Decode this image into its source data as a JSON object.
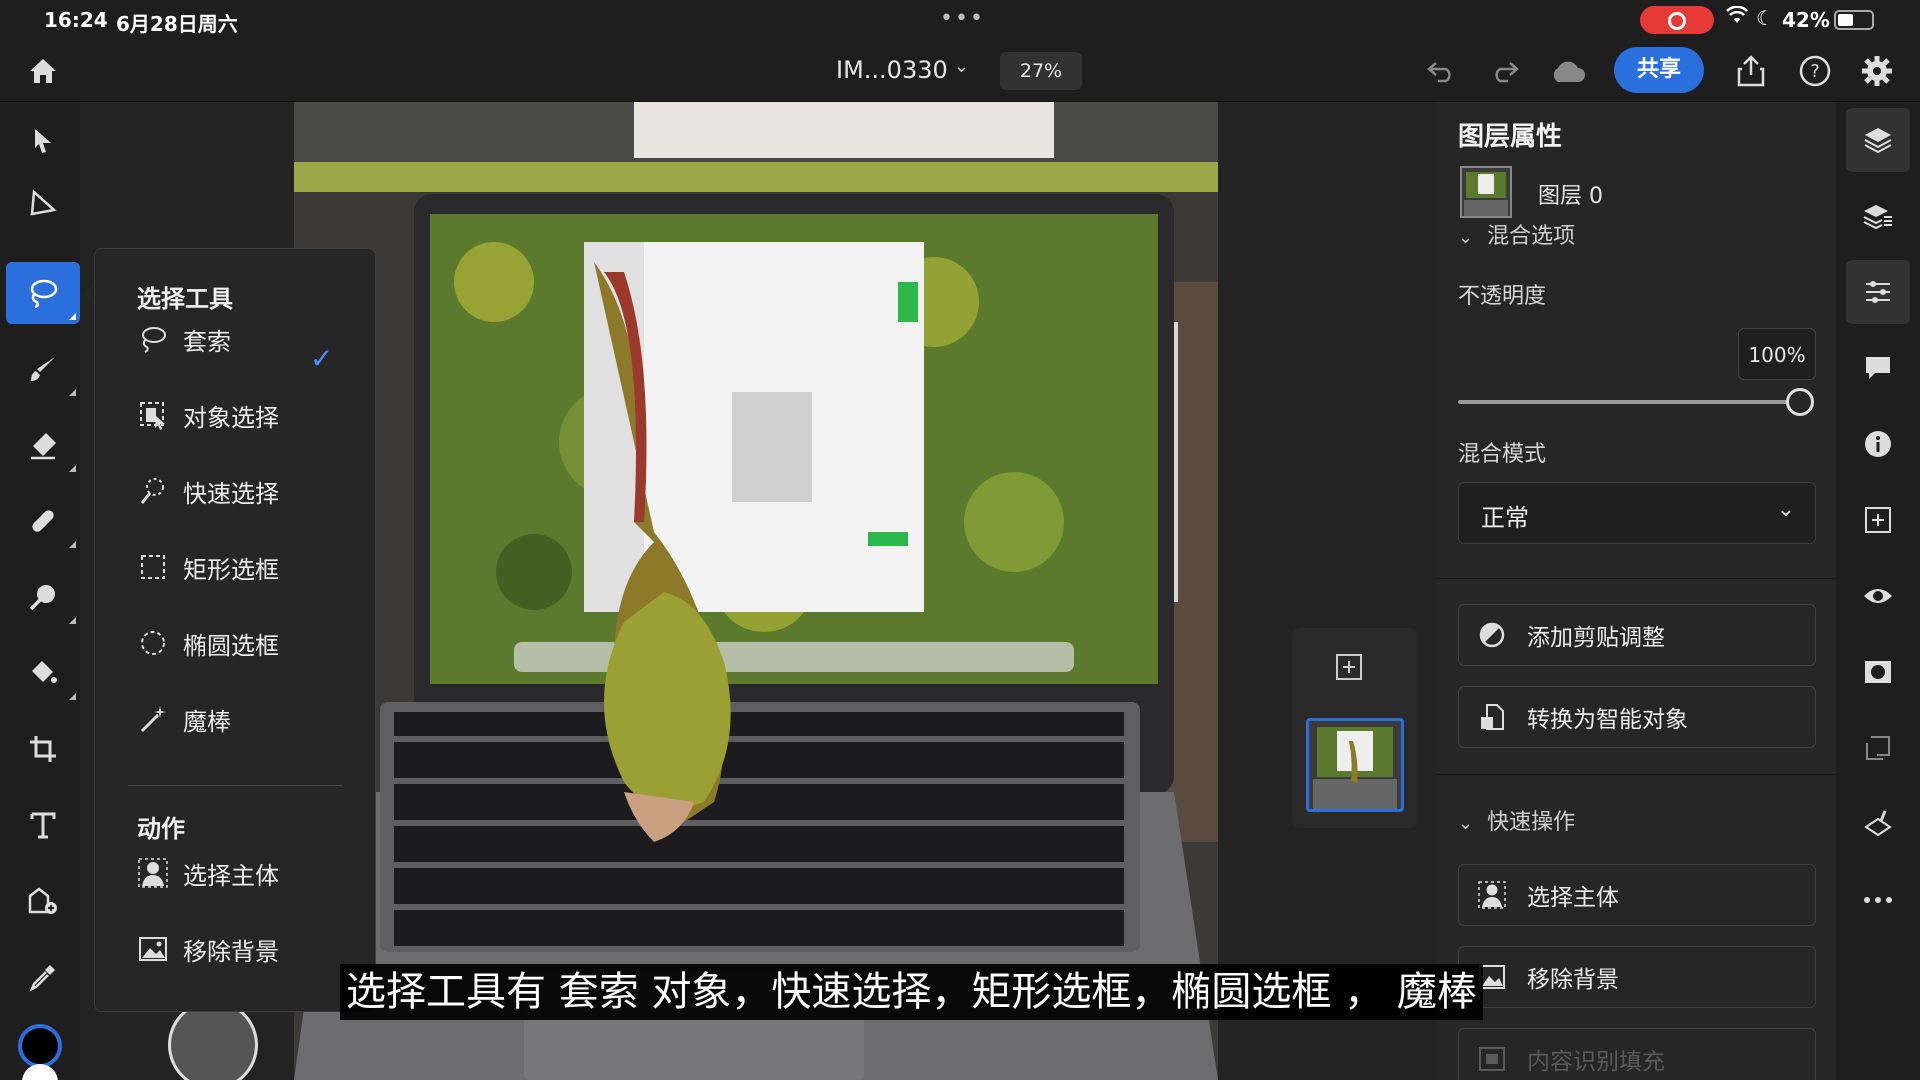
{
  "status_bar": {
    "time": "16:24",
    "date": "6月28日周六",
    "battery": "42%"
  },
  "toolbar": {
    "doc_title": "IM...0330",
    "zoom": "27%",
    "share_label": "共享"
  },
  "selection_popup": {
    "heading": "选择工具",
    "tools": [
      {
        "label": "套索",
        "icon": "lasso-icon",
        "checked": true
      },
      {
        "label": "对象选择",
        "icon": "object-select-icon"
      },
      {
        "label": "快速选择",
        "icon": "quick-select-icon"
      },
      {
        "label": "矩形选框",
        "icon": "rect-marquee-icon"
      },
      {
        "label": "椭圆选框",
        "icon": "ellipse-marquee-icon"
      },
      {
        "label": "魔棒",
        "icon": "magic-wand-icon"
      }
    ],
    "actions_heading": "动作",
    "actions": [
      {
        "label": "选择主体",
        "icon": "select-subject-icon"
      },
      {
        "label": "移除背景",
        "icon": "remove-bg-icon"
      }
    ]
  },
  "right_panel": {
    "title": "图层属性",
    "layer_name": "图层 0",
    "blend_section": "混合选项",
    "opacity_label": "不透明度",
    "opacity_value": "100%",
    "opacity_level": 1.0,
    "blend_mode_label": "混合模式",
    "blend_mode_value": "正常",
    "add_clip_label": "添加剪贴调整",
    "convert_smart_label": "转换为智能对象",
    "quick_actions_section": "快速操作",
    "quick_actions": [
      {
        "label": "选择主体"
      },
      {
        "label": "移除背景"
      },
      {
        "label": "内容识别填充",
        "disabled": true
      }
    ]
  },
  "subtitle": "选择工具有 套索 对象，快速选择，矩形选框，椭圆选框 ， 魔棒",
  "colors": {
    "accent": "#2a6fdb",
    "record": "#e53935",
    "panel": "#262626"
  }
}
